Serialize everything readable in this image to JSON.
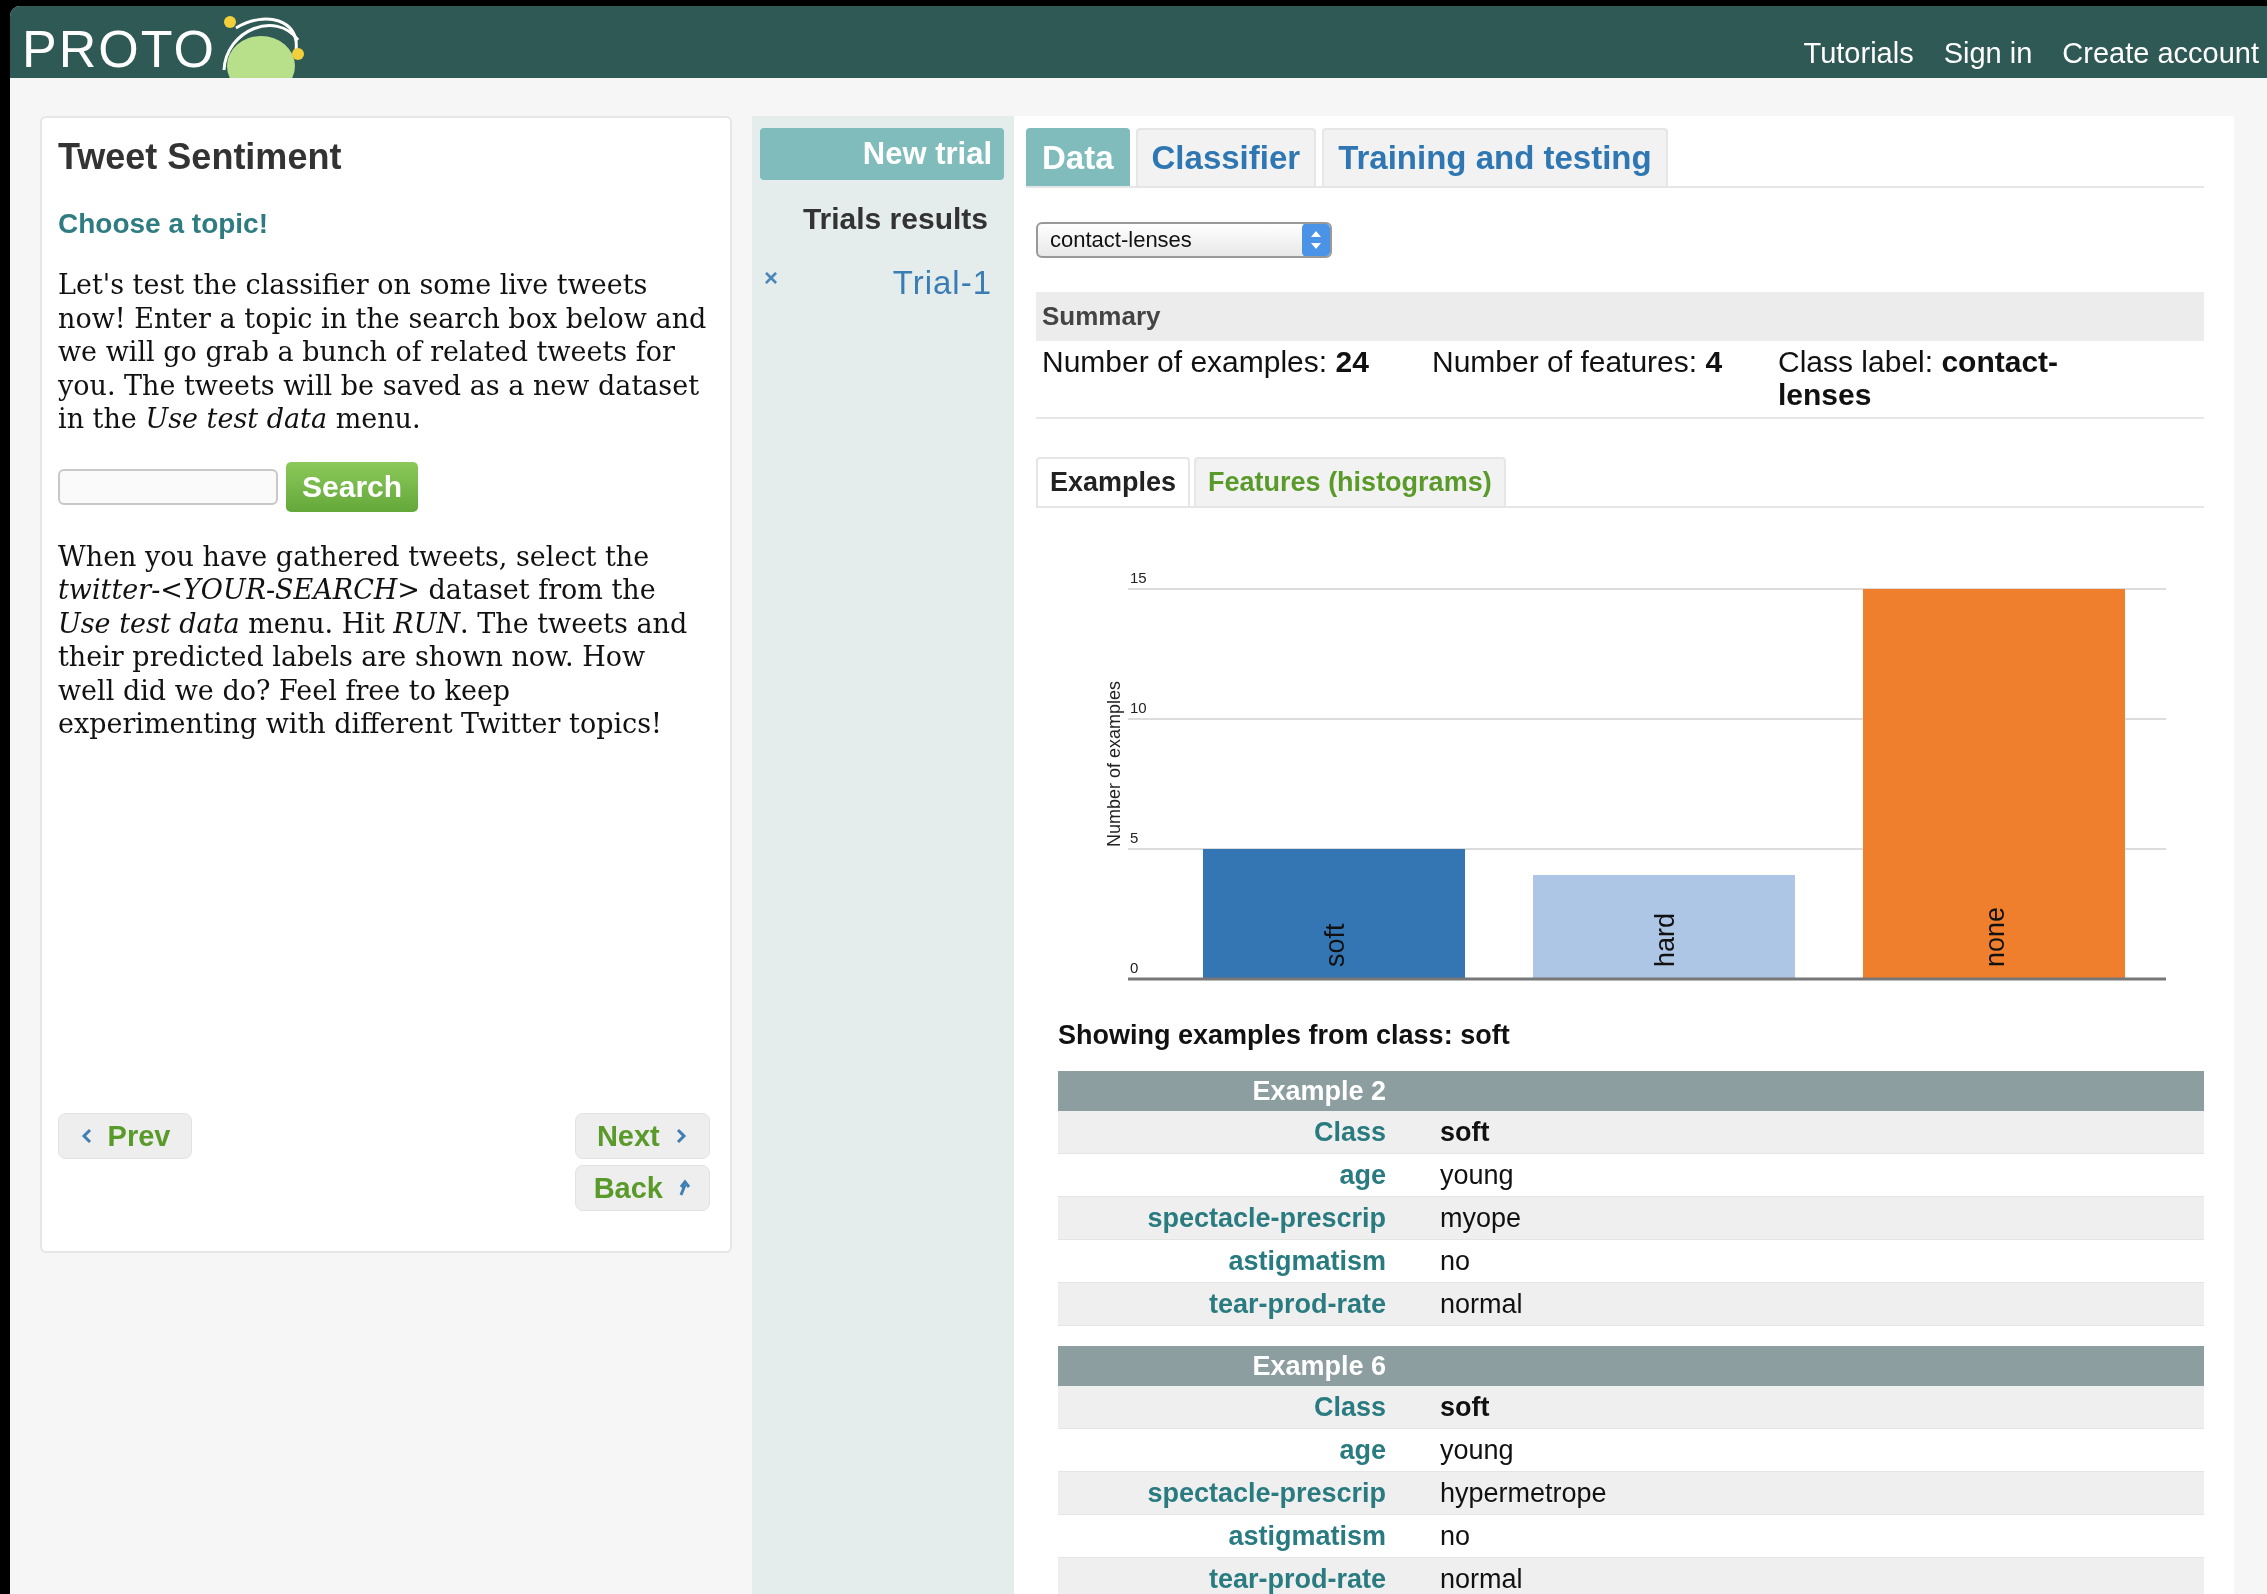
{
  "header": {
    "logo": "PROTO",
    "nav": [
      "Tutorials",
      "Sign in",
      "Create account"
    ]
  },
  "lesson": {
    "title": "Tweet Sentiment",
    "subtitle": "Choose a topic!",
    "paragraphs": [
      "Let's test the classifier on some live tweets now! Enter a topic in the search box below and we will go grab a bunch of related tweets for you. The tweets will be saved as a new dataset in the *Use test data* menu.",
      "When you have gathered tweets, select the *twitter-<YOUR-SEARCH>* dataset from the *Use test data* menu. Hit *RUN*. The tweets and their predicted labels are shown now. How well did we do? Feel free to keep experimenting with different Twitter topics!"
    ],
    "search_button": "Search",
    "nav_buttons": [
      {
        "kind": "prev",
        "label": "Prev"
      },
      {
        "kind": "next",
        "label": "Next"
      },
      {
        "kind": "back",
        "label": "Back"
      }
    ]
  },
  "trials": {
    "new_button": "New trial",
    "heading": "Trials results",
    "items": [
      {
        "remove": "×",
        "label": "Trial-1"
      }
    ]
  },
  "tabs": [
    {
      "label": "Data",
      "selected": true
    },
    {
      "label": "Classifier",
      "selected": false
    },
    {
      "label": "Training and testing",
      "selected": false
    }
  ],
  "dataset_select": {
    "value": "contact-lenses"
  },
  "summary": {
    "title": "Summary",
    "stats": [
      "Number of examples: **24**",
      "Number of features: **4**",
      "Class label: **contact-lenses**"
    ]
  },
  "subtabs": [
    {
      "label": "Examples",
      "selected": true
    },
    {
      "label": "Features (histograms)",
      "selected": false
    }
  ],
  "chart_data": {
    "type": "bar",
    "ylabel": "Number of examples",
    "ylim": [
      0,
      15
    ],
    "yticks": [
      0,
      5,
      10,
      15
    ],
    "series": [
      {
        "name": "soft",
        "color": "#3376b3",
        "values": [
          5,
          null,
          null
        ]
      },
      {
        "name": "hard",
        "color": "#aec6e6",
        "values": [
          null,
          4,
          null
        ]
      },
      {
        "name": "none",
        "color": "#ef7f2c",
        "values": [
          null,
          null,
          15
        ]
      }
    ]
  },
  "caption": "Showing examples from class: soft",
  "examples": [
    {
      "title": "Example 2",
      "rows": [
        {
          "kind": "class",
          "attribute": "Class",
          "value": "soft"
        },
        {
          "kind": "feature",
          "attribute": "age",
          "value": "young"
        },
        {
          "kind": "feature",
          "attribute": "spectacle-prescrip",
          "value": "myope"
        },
        {
          "kind": "feature",
          "attribute": "astigmatism",
          "value": "no"
        },
        {
          "kind": "feature",
          "attribute": "tear-prod-rate",
          "value": "normal"
        }
      ]
    },
    {
      "title": "Example 6",
      "rows": [
        {
          "kind": "class",
          "attribute": "Class",
          "value": "soft"
        },
        {
          "kind": "feature",
          "attribute": "age",
          "value": "young"
        },
        {
          "kind": "feature",
          "attribute": "spectacle-prescrip",
          "value": "hypermetrope"
        },
        {
          "kind": "feature",
          "attribute": "astigmatism",
          "value": "no"
        },
        {
          "kind": "feature",
          "attribute": "tear-prod-rate",
          "value": "normal"
        }
      ]
    }
  ]
}
